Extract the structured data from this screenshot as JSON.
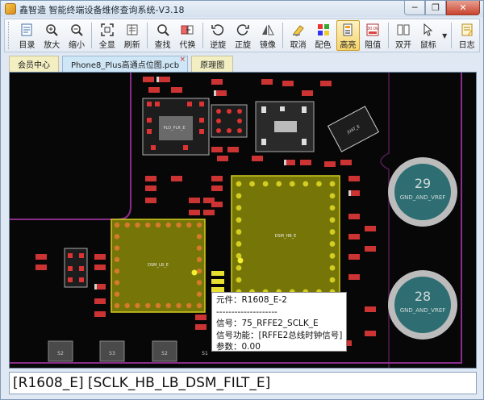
{
  "window": {
    "title": "鑫智造 智能终端设备维修查询系统-V3.18",
    "buttons": {
      "minimize": "─",
      "restore": "❐",
      "close": "✕"
    }
  },
  "toolbar": {
    "items": [
      {
        "label": "目录",
        "icon": "catalog-icon"
      },
      {
        "label": "放大",
        "icon": "zoom-in-icon"
      },
      {
        "label": "缩小",
        "icon": "zoom-out-icon"
      },
      {
        "label": "全显",
        "icon": "fit-all-icon"
      },
      {
        "label": "刷新",
        "icon": "refresh-icon"
      },
      {
        "label": "查找",
        "icon": "search-icon"
      },
      {
        "label": "代换",
        "icon": "replace-icon"
      },
      {
        "label": "逆旋",
        "icon": "rotate-ccw-icon"
      },
      {
        "label": "正旋",
        "icon": "rotate-cw-icon"
      },
      {
        "label": "镜像",
        "icon": "mirror-icon"
      },
      {
        "label": "取消",
        "icon": "cancel-icon"
      },
      {
        "label": "配色",
        "icon": "color-icon"
      },
      {
        "label": "高亮",
        "icon": "highlight-icon"
      },
      {
        "label": "阻值",
        "icon": "resistance-icon"
      },
      {
        "label": "双开",
        "icon": "dual-open-icon"
      },
      {
        "label": "鼠标",
        "icon": "mouse-icon"
      },
      {
        "label": "日志",
        "icon": "log-icon"
      }
    ]
  },
  "tabs": [
    {
      "label": "会员中心"
    },
    {
      "label": "Phone8_Plus高通点位图.pcb",
      "close": "×"
    },
    {
      "label": "原理图"
    }
  ],
  "pcb": {
    "labels": {
      "pmic": "PLO_PLR_E",
      "dsm_lb": "DSM_LB_E",
      "dsm_hb": "DSM_HB_E",
      "juat": "JUAT_E",
      "gnd1": "29",
      "gnd2": "28",
      "gnd_label": "GND_AND_VREF",
      "s2": "S2",
      "s3": "S3",
      "s2b": "S2",
      "s1": "S1"
    }
  },
  "tooltip": {
    "part": "元件：R1608_E-2",
    "divider": "--------------------",
    "signal": "信号：75_RFFE2_SCLK_E",
    "function": "信号功能：[RFFE2总线时钟信号]",
    "param": "参数：0.00"
  },
  "status": {
    "text": "[R1608_E] [SCLK_HB_LB_DSM_FILT_E]"
  },
  "colors": {
    "pcb_bg": "#070707",
    "outline": "#8a2d8a",
    "chip": "#7a7a10",
    "pad": "#d4cc20",
    "gnd": "#2e6e73"
  }
}
